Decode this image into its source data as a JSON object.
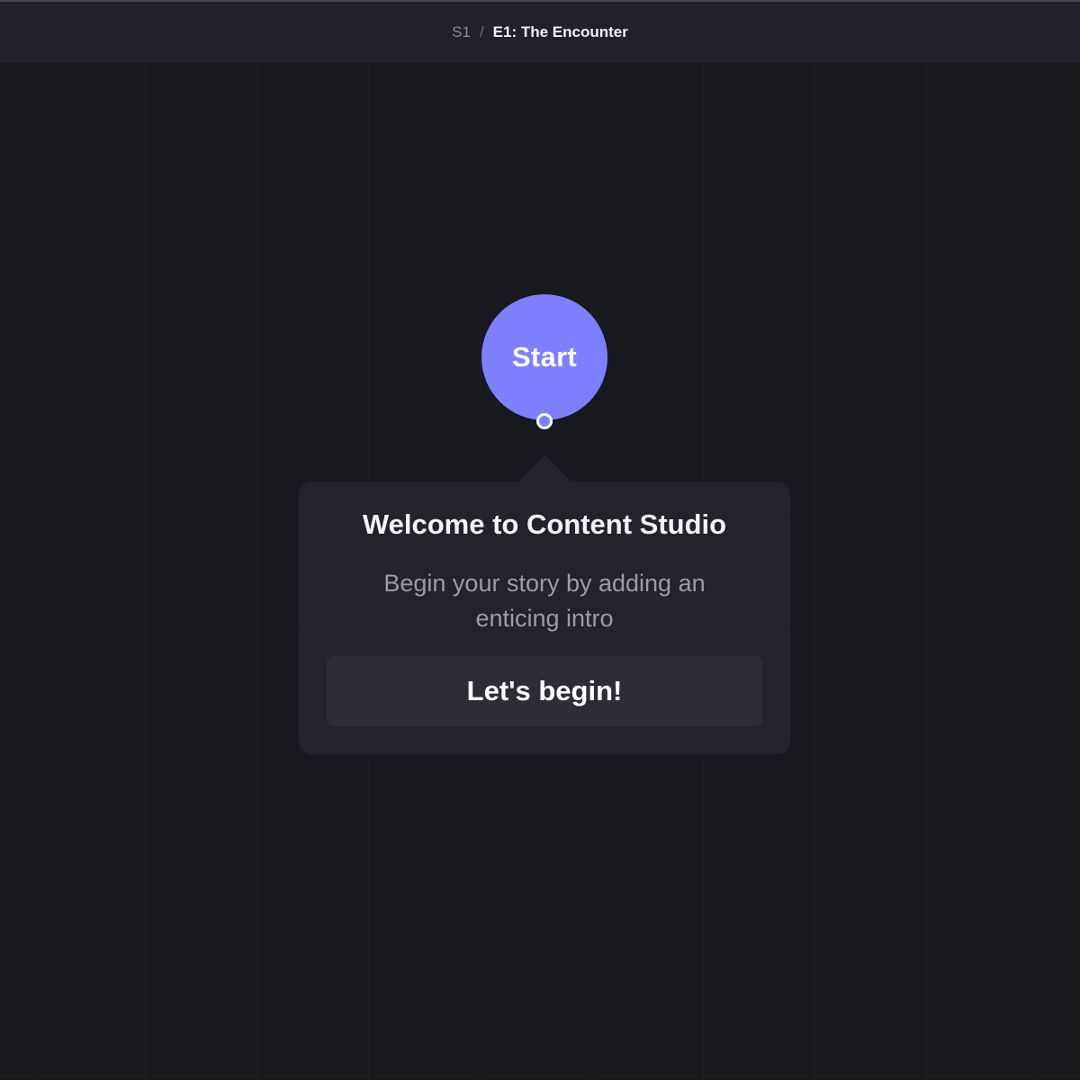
{
  "breadcrumb": {
    "season": "S1",
    "separator": "/",
    "episode": "E1: The Encounter"
  },
  "canvas": {
    "start_node_label": "Start"
  },
  "welcome_popover": {
    "title": "Welcome to Content Studio",
    "text": "Begin your story by adding an enticing intro",
    "button_label": "Let's begin!"
  },
  "colors": {
    "accent": "#7c80ff",
    "canvas_background": "#18191e",
    "topbar_background": "#202129",
    "popover_background": "#22232b",
    "button_background": "#2c2d37"
  }
}
